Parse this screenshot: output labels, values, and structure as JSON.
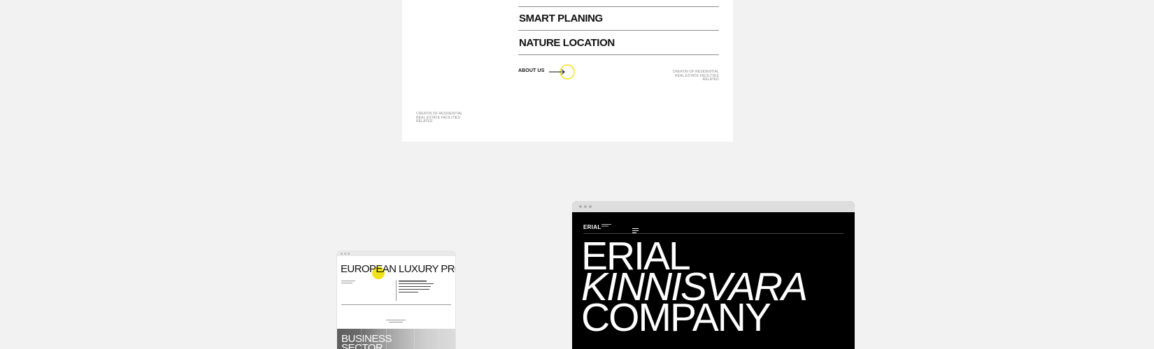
{
  "top_card": {
    "features": [
      "SMART PLANING",
      "NATURE LOCATION"
    ],
    "about_label": "ABOUT US",
    "note_right": [
      "CREATIN OF RESIDENTIAL",
      "REAL ESTATE FACILITIES",
      "RELATED"
    ],
    "note_left": [
      "CREATIN OF RESIDENTIAL",
      "REAL ESTATE FACILITIES",
      "RELATED"
    ],
    "accent_color": "#f2e21c"
  },
  "tablet": {
    "title": "EUROPEAN LUXURY PRO",
    "photo_text": [
      "BUSINESS",
      "SECTOR"
    ],
    "accent_color": "#f2e21c"
  },
  "desktop": {
    "logo": "ERIAL",
    "menu_icon": "hamburger-icon",
    "hero": {
      "line1": "ERIAL",
      "line2": "KINNISVARA",
      "line3": "COMPANY"
    }
  }
}
